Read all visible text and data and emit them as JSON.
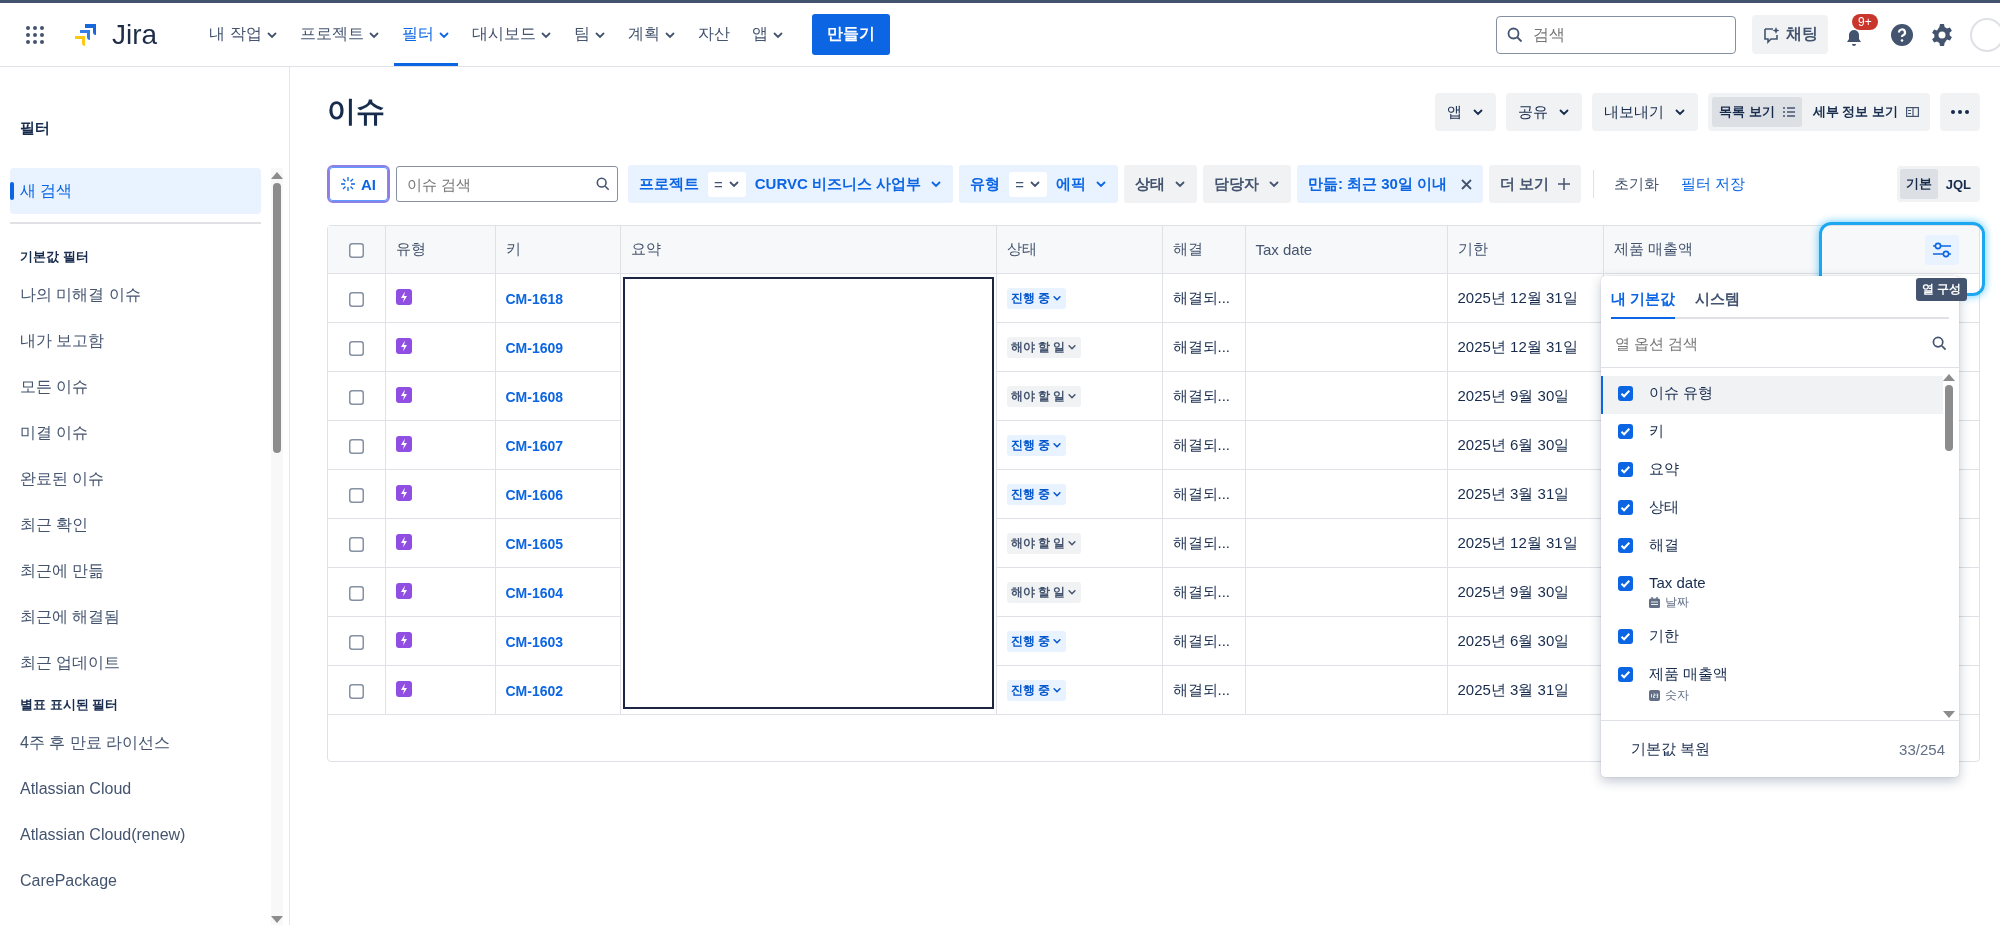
{
  "top_nav": {
    "product_name": "Jira",
    "menus": [
      {
        "label": "내 작업",
        "has_menu": true,
        "selected": false
      },
      {
        "label": "프로젝트",
        "has_menu": true,
        "selected": false
      },
      {
        "label": "필터",
        "has_menu": true,
        "selected": true
      },
      {
        "label": "대시보드",
        "has_menu": true,
        "selected": false
      },
      {
        "label": "팀",
        "has_menu": true,
        "selected": false
      },
      {
        "label": "계획",
        "has_menu": true,
        "selected": false
      },
      {
        "label": "자산",
        "has_menu": false,
        "selected": false
      },
      {
        "label": "앱",
        "has_menu": true,
        "selected": false
      }
    ],
    "create_button": "만들기",
    "search": {
      "placeholder": "검색"
    },
    "chat_button": "채팅",
    "notification_count": "9+"
  },
  "sidebar": {
    "title": "필터",
    "items": [
      {
        "label": "새 검색",
        "selected": true
      }
    ],
    "sections": [
      {
        "title": "기본값 필터",
        "items": [
          {
            "label": "나의 미해결 이슈",
            "selected": false
          },
          {
            "label": "내가 보고함",
            "selected": false
          },
          {
            "label": "모든 이슈",
            "selected": false
          },
          {
            "label": "미결 이슈",
            "selected": false
          },
          {
            "label": "완료된 이슈",
            "selected": false
          },
          {
            "label": "최근 확인",
            "selected": false
          },
          {
            "label": "최근에 만듦",
            "selected": false
          },
          {
            "label": "최근에 해결됨",
            "selected": false
          },
          {
            "label": "최근 업데이트",
            "selected": false
          }
        ]
      },
      {
        "title": "별표 표시된 필터",
        "items": [
          {
            "label": "4주 후 만료 라이선스",
            "selected": false
          },
          {
            "label": "Atlassian Cloud",
            "selected": false
          },
          {
            "label": "Atlassian Cloud(renew)",
            "selected": false
          },
          {
            "label": "CarePackage",
            "selected": false
          }
        ]
      }
    ]
  },
  "page": {
    "title": "이슈",
    "actions": [
      {
        "label": "앱"
      },
      {
        "label": "공유"
      },
      {
        "label": "내보내기"
      }
    ],
    "views": [
      {
        "label": "목록 보기",
        "kind": "list",
        "selected": true
      },
      {
        "label": "세부 정보 보기",
        "kind": "detail",
        "selected": false
      }
    ]
  },
  "filter_bar": {
    "ai_button": "AI",
    "search": {
      "placeholder": "이슈 검색"
    },
    "chips": [
      {
        "kind": "operator",
        "field": "프로젝트",
        "operator": "=",
        "value": "CURVC 비즈니스 사업부"
      },
      {
        "kind": "operator",
        "field": "유형",
        "operator": "=",
        "value": "에픽"
      },
      {
        "kind": "plain",
        "field": "상태"
      },
      {
        "kind": "plain",
        "field": "담당자"
      },
      {
        "kind": "removable",
        "field": "만듦: 최근 30일 이내"
      }
    ],
    "more_button": "더 보기",
    "reset_button": "초기화",
    "save_link": "필터 저장",
    "modes": [
      {
        "label": "기본",
        "selected": true
      },
      {
        "label": "JQL",
        "selected": false
      }
    ]
  },
  "table": {
    "all_selected": false,
    "columns": [
      "유형",
      "키",
      "요약",
      "상태",
      "해결",
      "Tax date",
      "기한",
      "제품 매출액"
    ],
    "rows": [
      {
        "selected": false,
        "key": "CM-1618",
        "status": {
          "label": "진행 중",
          "kind": "in_progress"
        },
        "resolution": "해결되...",
        "due": "2025년 12월 31일"
      },
      {
        "selected": false,
        "key": "CM-1609",
        "status": {
          "label": "해야 할 일",
          "kind": "todo"
        },
        "resolution": "해결되...",
        "due": "2025년 12월 31일"
      },
      {
        "selected": false,
        "key": "CM-1608",
        "status": {
          "label": "해야 할 일",
          "kind": "todo"
        },
        "resolution": "해결되...",
        "due": "2025년 9월 30일"
      },
      {
        "selected": false,
        "key": "CM-1607",
        "status": {
          "label": "진행 중",
          "kind": "in_progress"
        },
        "resolution": "해결되...",
        "due": "2025년 6월 30일"
      },
      {
        "selected": false,
        "key": "CM-1606",
        "status": {
          "label": "진행 중",
          "kind": "in_progress"
        },
        "resolution": "해결되...",
        "due": "2025년 3월 31일"
      },
      {
        "selected": false,
        "key": "CM-1605",
        "status": {
          "label": "해야 할 일",
          "kind": "todo"
        },
        "resolution": "해결되...",
        "due": "2025년 12월 31일"
      },
      {
        "selected": false,
        "key": "CM-1604",
        "status": {
          "label": "해야 할 일",
          "kind": "todo"
        },
        "resolution": "해결되...",
        "due": "2025년 9월 30일"
      },
      {
        "selected": false,
        "key": "CM-1603",
        "status": {
          "label": "진행 중",
          "kind": "in_progress"
        },
        "resolution": "해결되...",
        "due": "2025년 6월 30일"
      },
      {
        "selected": false,
        "key": "CM-1602",
        "status": {
          "label": "진행 중",
          "kind": "in_progress"
        },
        "resolution": "해결되...",
        "due": "2025년 3월 31일"
      }
    ]
  },
  "column_panel": {
    "tooltip": "열 구성",
    "tabs": [
      {
        "label": "내 기본값",
        "selected": true
      },
      {
        "label": "시스템",
        "selected": false
      }
    ],
    "search": {
      "placeholder": "열 옵션 검색"
    },
    "options": [
      {
        "label": "이슈 유형",
        "checked": true,
        "focused": true
      },
      {
        "label": "키",
        "checked": true,
        "focused": false
      },
      {
        "label": "요약",
        "checked": true,
        "focused": false
      },
      {
        "label": "상태",
        "checked": true,
        "focused": false
      },
      {
        "label": "해결",
        "checked": true,
        "focused": false
      },
      {
        "label": "Tax date",
        "checked": true,
        "focused": false,
        "field_type": {
          "kind": "date",
          "label": "날짜"
        }
      },
      {
        "label": "기한",
        "checked": true,
        "focused": false
      },
      {
        "label": "제품 매출액",
        "checked": true,
        "focused": false,
        "field_type": {
          "kind": "number",
          "label": "숫자"
        }
      }
    ],
    "reset_button": "기본값 복원",
    "count": "33/254"
  }
}
